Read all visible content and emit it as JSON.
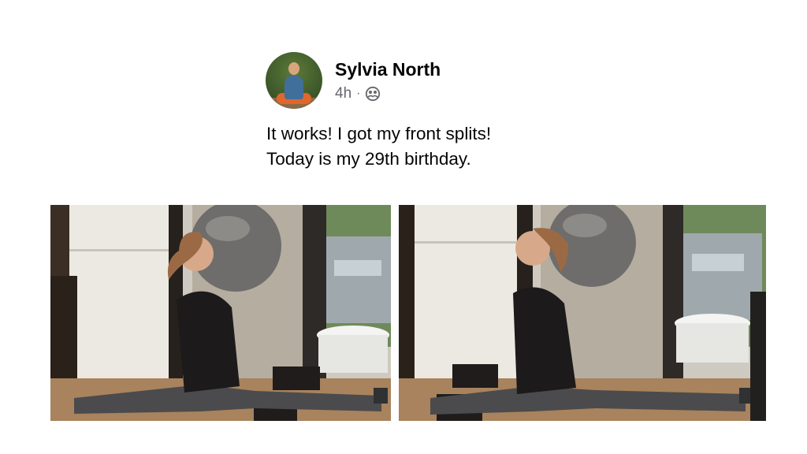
{
  "post": {
    "author": "Sylvia North",
    "time": "4h",
    "separator": "·",
    "privacy_icon": "friends-icon",
    "text_lines": [
      "It works! I got my front splits!",
      "Today is my 29th birthday."
    ]
  },
  "photos": [
    {
      "description_name": "photo-splits-1"
    },
    {
      "description_name": "photo-splits-2"
    }
  ],
  "colors": {
    "name": "#050505",
    "secondary": "#65676b",
    "background": "#ffffff"
  }
}
